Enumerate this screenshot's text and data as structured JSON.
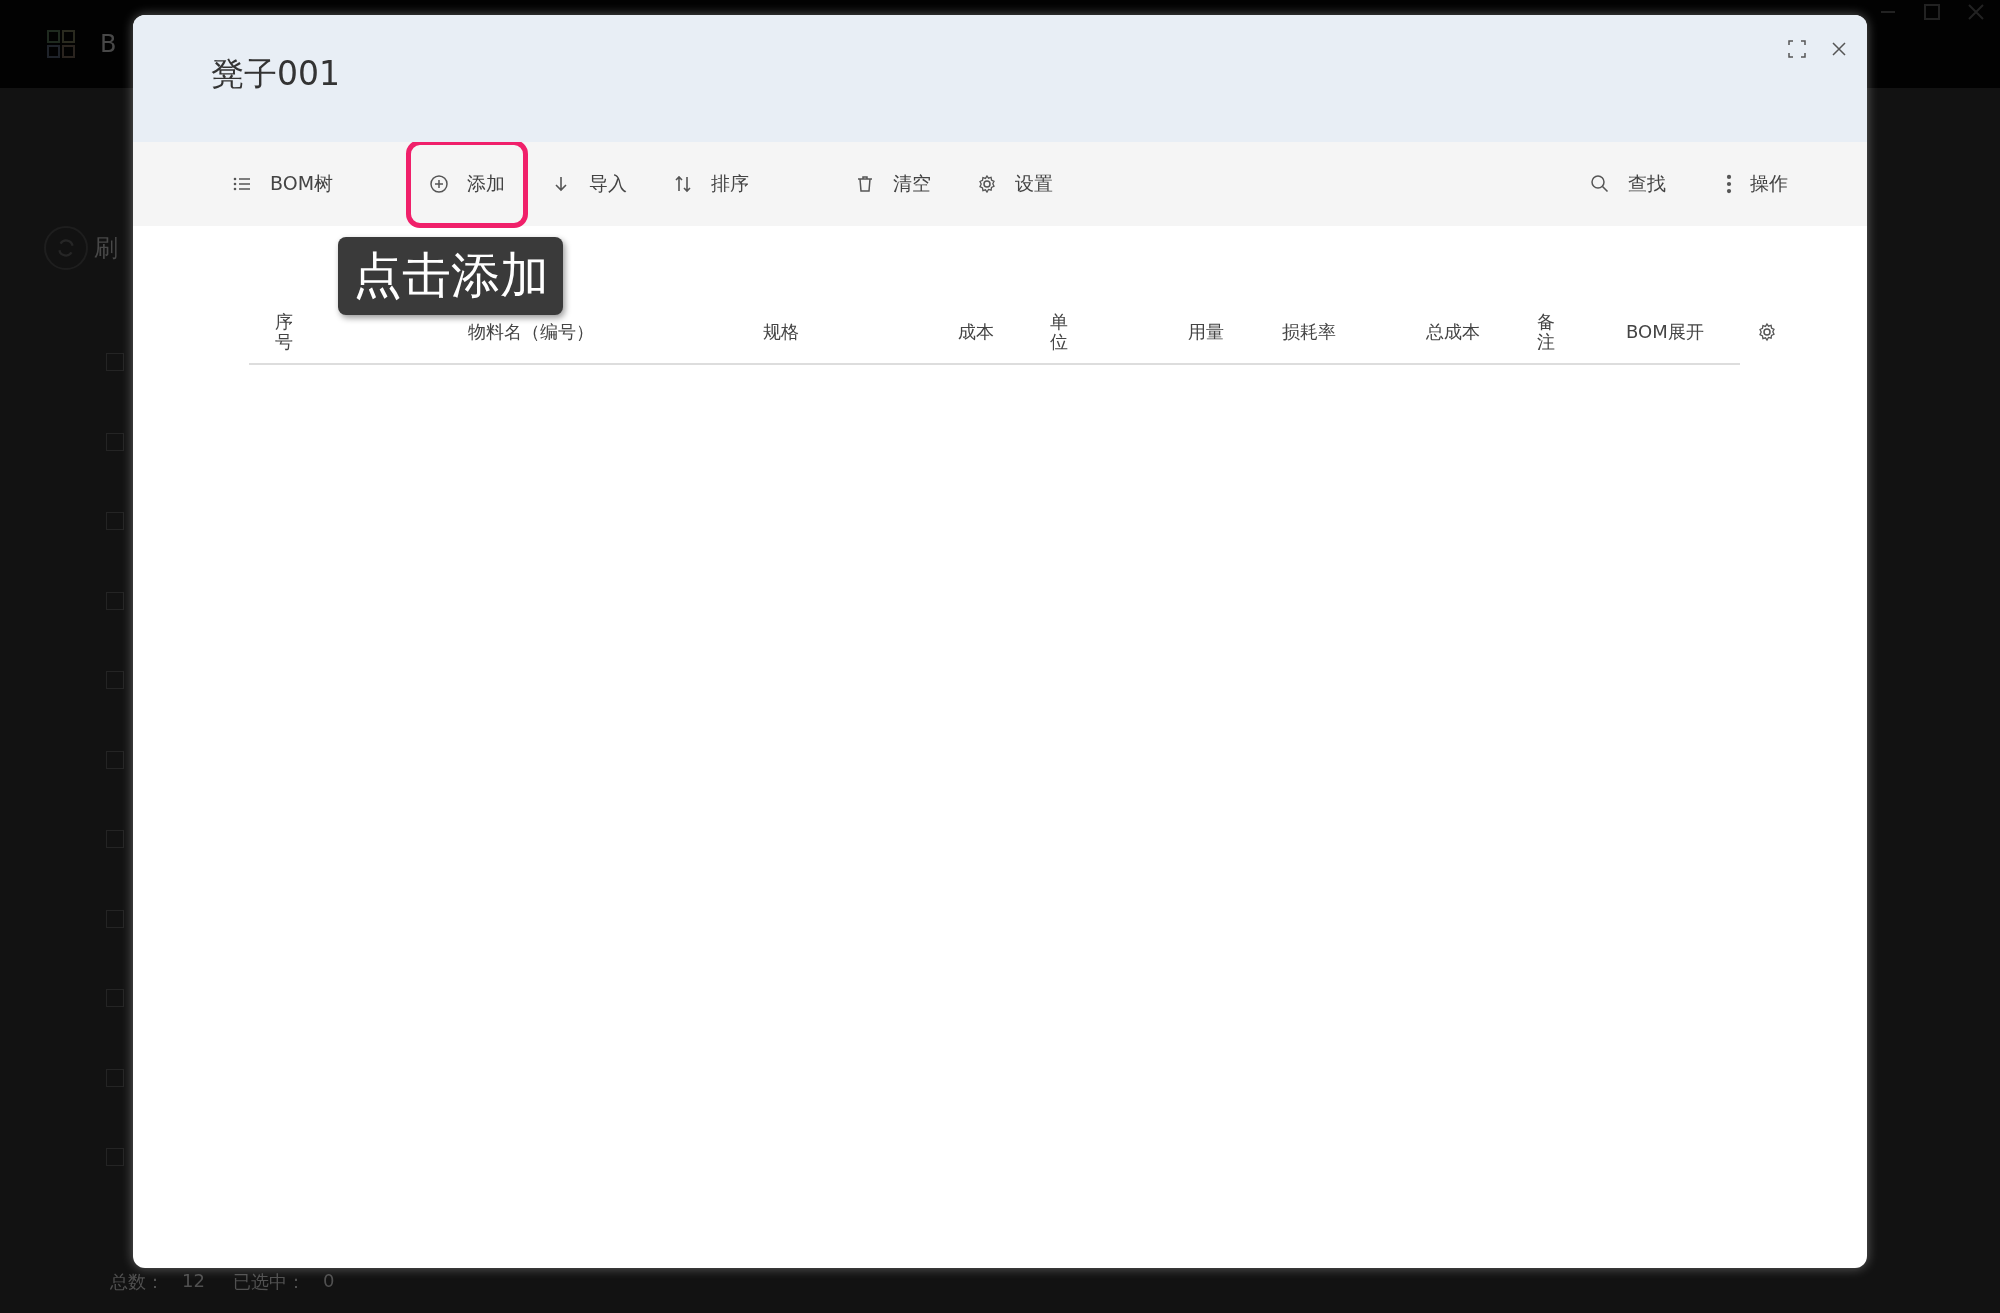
{
  "background": {
    "app_name": "B",
    "refresh_label": "刷",
    "checkboxes": [
      {
        "checked": false
      },
      {
        "checked": false
      },
      {
        "checked": false
      },
      {
        "checked": false
      },
      {
        "checked": false
      },
      {
        "checked": false
      },
      {
        "checked": false
      },
      {
        "checked": false
      },
      {
        "checked": false
      },
      {
        "checked": false
      },
      {
        "checked": false
      }
    ],
    "footer": [
      {
        "label": "总数：",
        "value": "12"
      },
      {
        "label": "已选中：",
        "value": "0"
      }
    ]
  },
  "dialog": {
    "title": "凳子001",
    "toolbar": [
      {
        "kind": "list",
        "label": "BOM树",
        "highlighted": false
      },
      {
        "kind": "add",
        "label": "添加",
        "highlighted": true
      },
      {
        "kind": "import",
        "label": "导入",
        "highlighted": false
      },
      {
        "kind": "sort",
        "label": "排序",
        "highlighted": false
      },
      {
        "kind": "trash",
        "label": "清空",
        "highlighted": false
      },
      {
        "kind": "gear",
        "label": "设置",
        "highlighted": false
      }
    ],
    "toolbar_right": [
      {
        "kind": "search",
        "label": "查找"
      },
      {
        "kind": "more",
        "label": "操作"
      }
    ],
    "tooltip": "点击添加",
    "table": {
      "columns": [
        "序号",
        "物料名（编号）",
        "规格",
        "成本",
        "单位",
        "用量",
        "损耗率",
        "总成本",
        "备注",
        "BOM展开"
      ]
    }
  }
}
